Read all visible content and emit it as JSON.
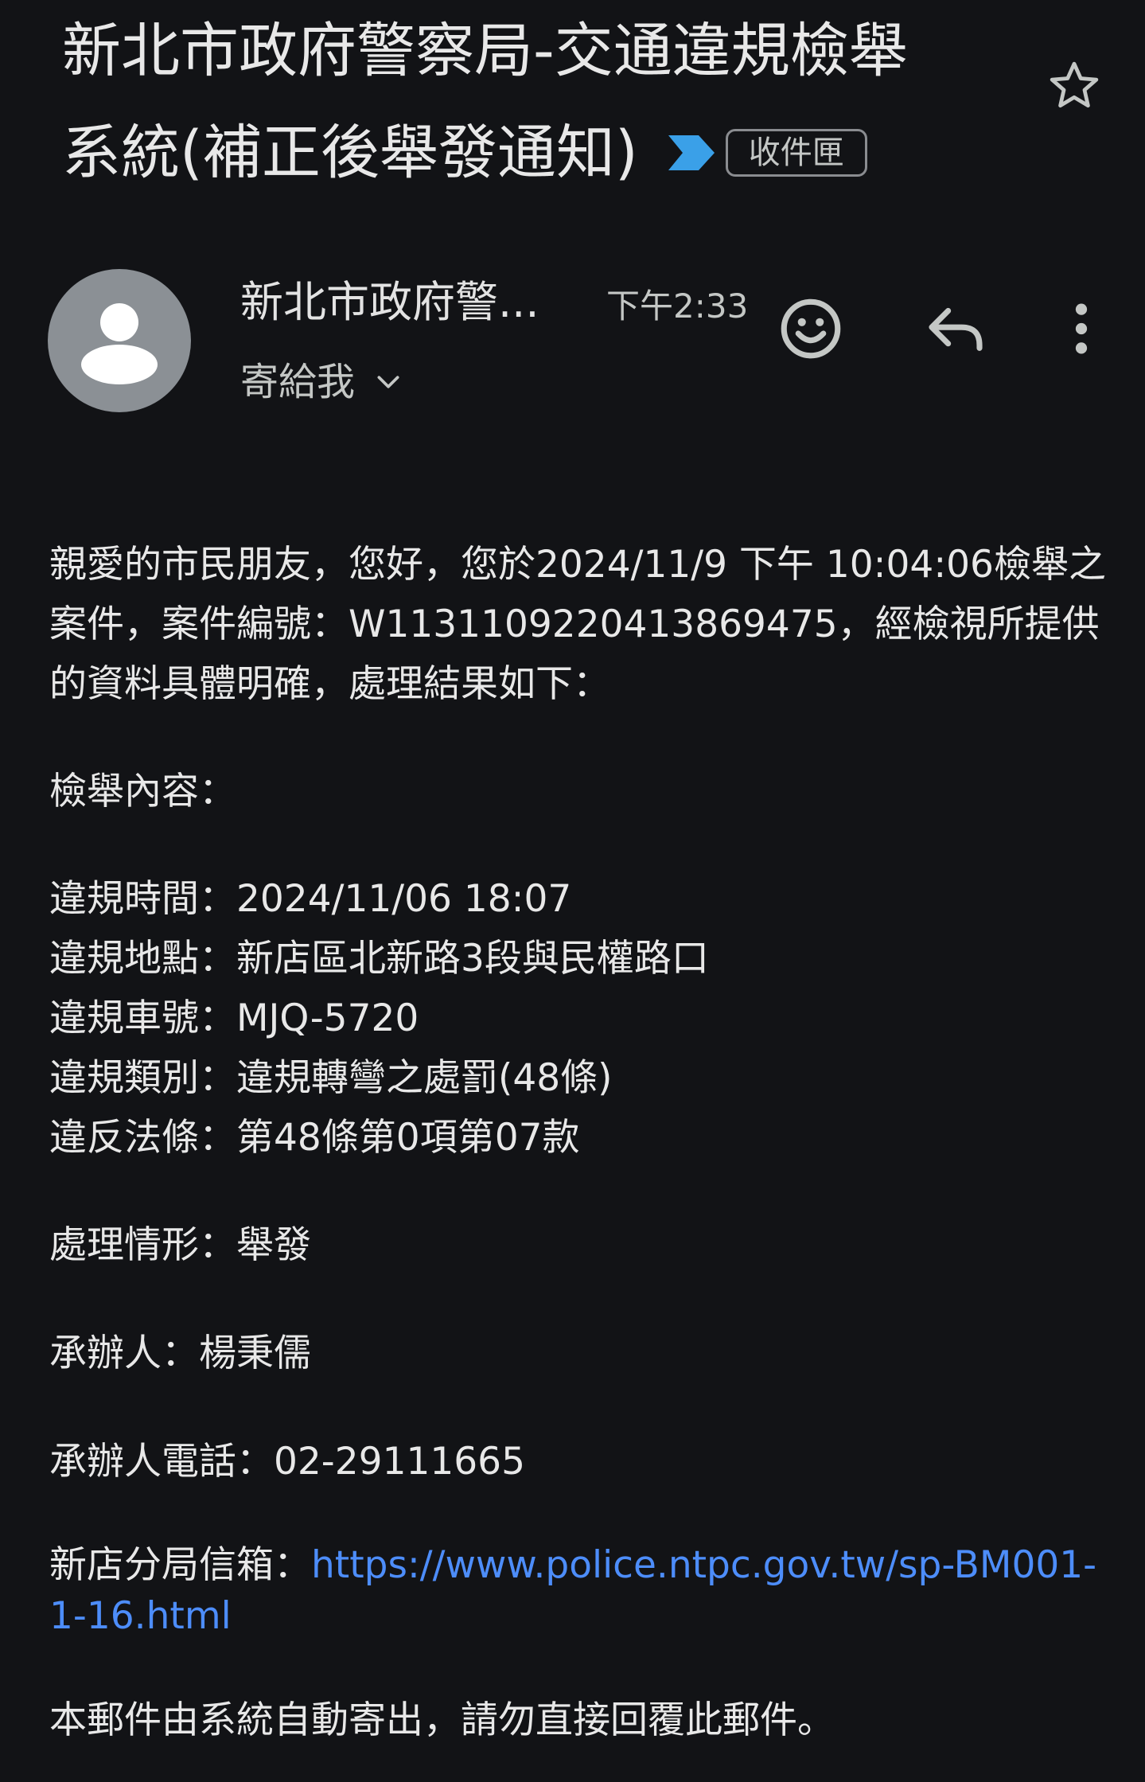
{
  "email": {
    "subject_line1": "新北市政府警察局-交通違規檢舉",
    "subject_line2": "系統(補正後舉發通知)",
    "label": "收件匣",
    "sender": "新北市政府警...",
    "time": "下午2:33",
    "recipient": "寄給我"
  },
  "icons": {
    "star": "star-outline-icon",
    "importance": "importance-marker-icon",
    "emoji": "add-reaction-emoji-icon",
    "reply": "reply-icon",
    "more": "more-vertical-icon",
    "chevron": "chevron-down-icon",
    "avatar": "person-avatar-icon"
  },
  "colors": {
    "background": "#121316",
    "importance": "#3aa0e8",
    "link": "#4d8dfa",
    "avatar_bg": "#8b9095"
  },
  "body": {
    "intro": "親愛的市民朋友，您好，您於2024/11/9 下午 10:04:06檢舉之案件，案件編號：W1131109220413869475，經檢視所提供的資料具體明確，處理結果如下：",
    "content_heading": "檢舉內容：",
    "violation_time": "違規時間：2024/11/06 18:07",
    "violation_place": "違規地點：新店區北新路3段與民權路口",
    "plate": "違規車號：MJQ-5720",
    "category": "違規類別：違規轉彎之處罰(48條)",
    "law": "違反法條：第48條第0項第07款",
    "handling": "處理情形：舉發",
    "handler": "承辦人：楊秉儒",
    "handler_phone": "承辦人電話：02-29111665",
    "mailbox_label": "新店分局信箱：",
    "mailbox_url": "https://www.police.ntpc.gov.tw/sp-BM001-1-16.html",
    "footer": "本郵件由系統自動寄出，請勿直接回覆此郵件。"
  }
}
